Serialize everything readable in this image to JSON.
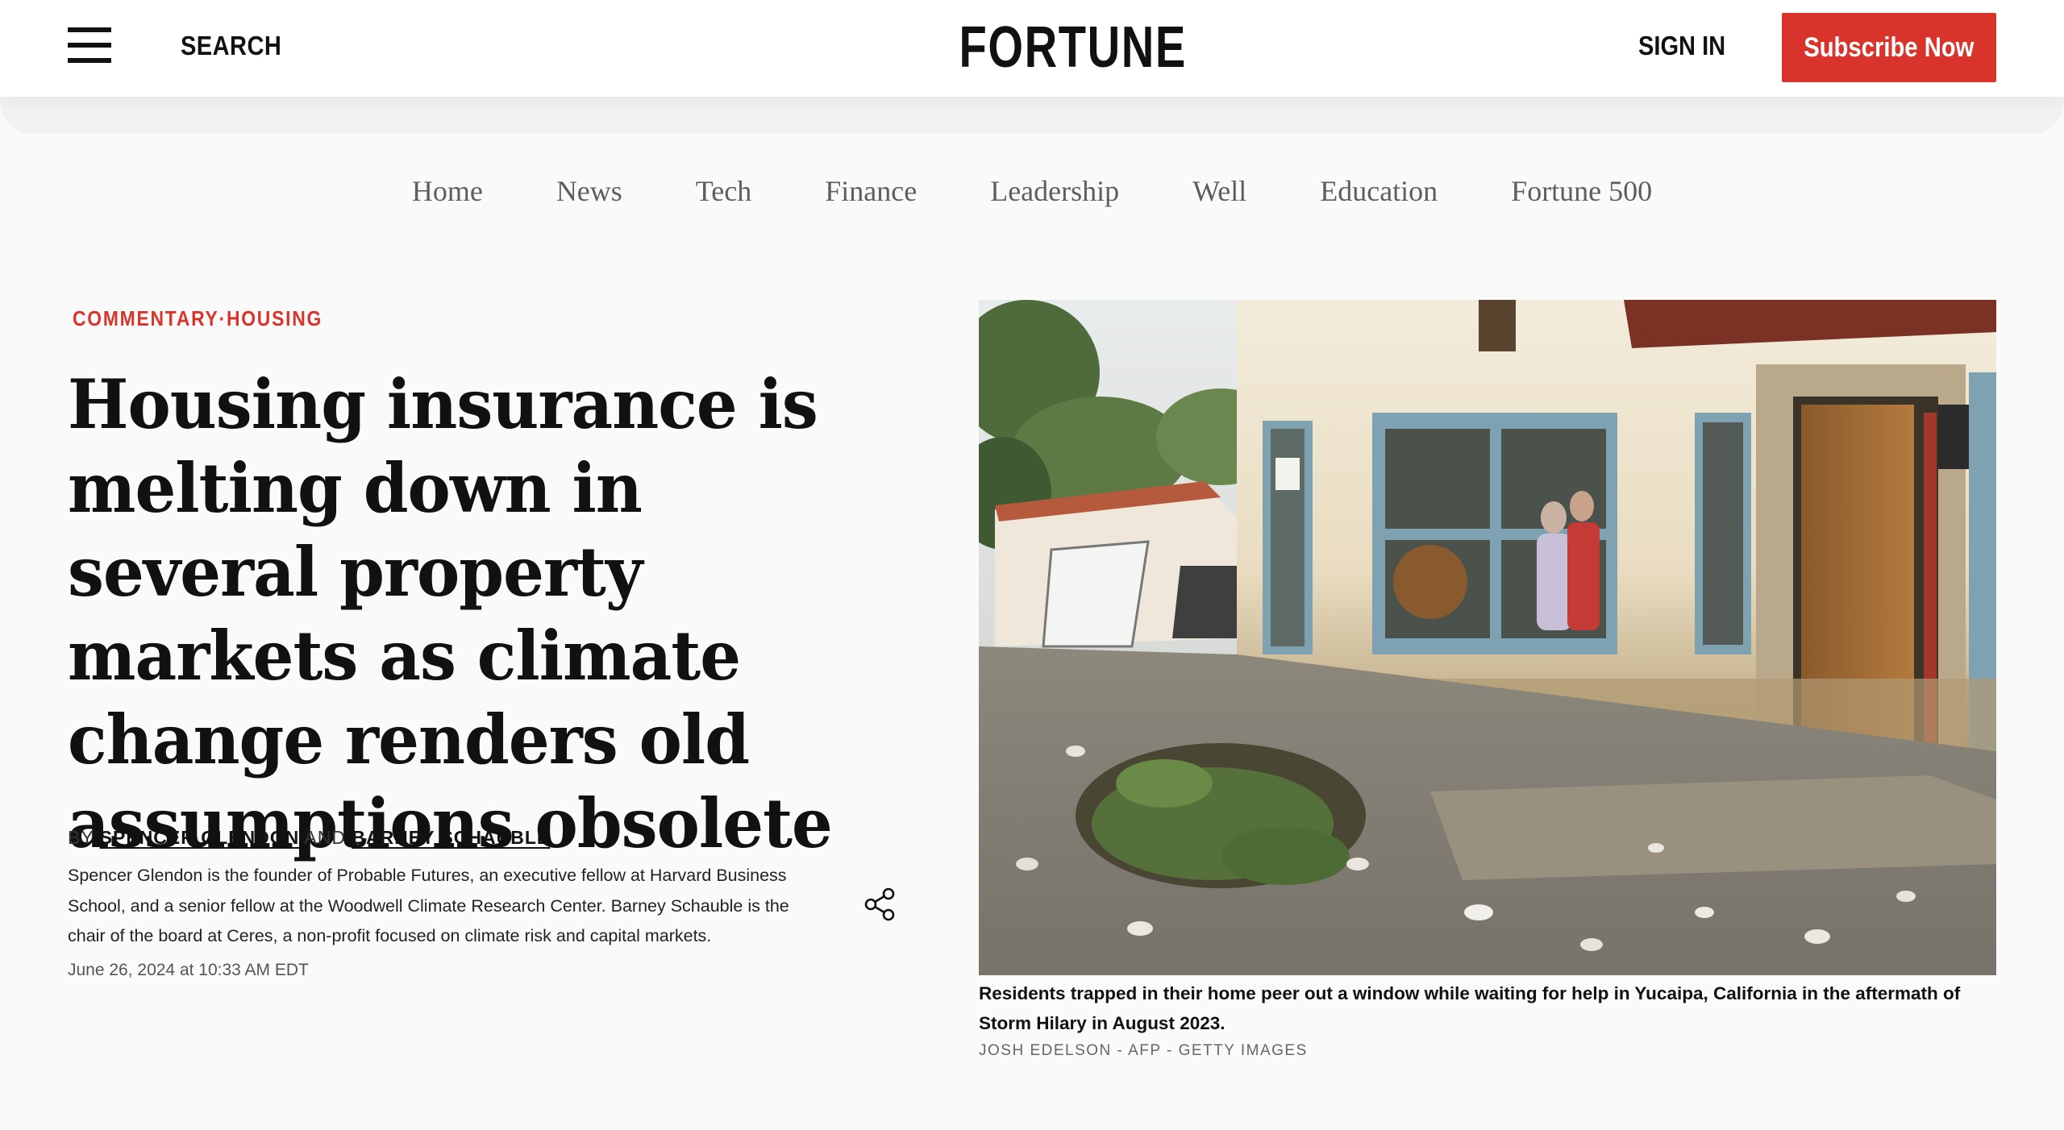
{
  "header": {
    "search_label": "SEARCH",
    "logo_text": "FORTUNE",
    "sign_in_label": "SIGN IN",
    "subscribe_label": "Subscribe Now",
    "subscribe_color": "#d9342b",
    "menu_icon": "hamburger-menu-icon"
  },
  "nav": {
    "items": [
      "Home",
      "News",
      "Tech",
      "Finance",
      "Leadership",
      "Well",
      "Education",
      "Fortune 500"
    ]
  },
  "article": {
    "kicker": [
      "COMMENTARY",
      "HOUSING"
    ],
    "kicker_separator": "·",
    "headline": "Housing insurance is melting down in several property markets as climate change renders old assumptions obsolete",
    "byline_prefix": "BY",
    "author_1": "SPENCER GLENDON",
    "byline_join": "AND",
    "author_2": "BARNEY SCHAUBLE",
    "bio": "Spencer Glendon is the founder of Probable Futures, an executive fellow at Harvard Business School, and a senior fellow at the Woodwell Climate Research Center. Barney Schauble is the chair of the board at Ceres, a non-profit focused on climate risk and capital markets.",
    "date": "June 26, 2024 at 10:33 AM EDT",
    "share_icon": "share-icon"
  },
  "image": {
    "caption": "Residents trapped in their home peer out a window while waiting for help in Yucaipa, California in the aftermath of Storm Hilary in August 2023.",
    "credit": "JOSH EDELSON - AFP - GETTY IMAGES"
  }
}
